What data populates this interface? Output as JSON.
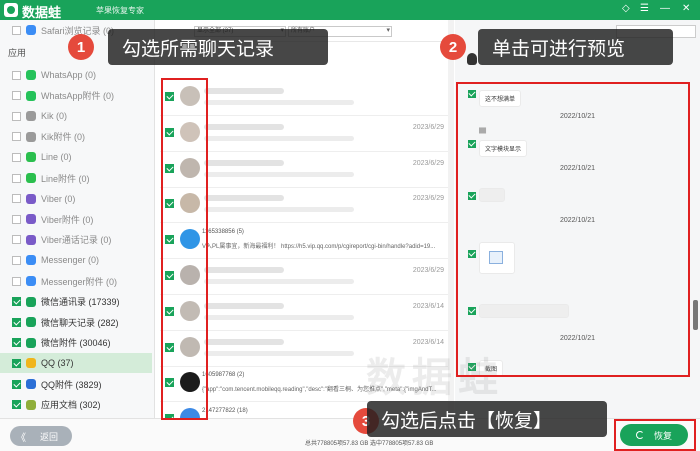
{
  "titlebar": {
    "app_name": "数据蛙",
    "subtitle": "苹果恢复专家",
    "controls": [
      "◇",
      "☰",
      "—",
      "✕"
    ]
  },
  "sidebar": {
    "top_item": "Safari浏览记录 (0)",
    "section_label": "应用",
    "items": [
      {
        "label": "WhatsApp (0)",
        "icon_color": "#25c25a",
        "checked": false
      },
      {
        "label": "WhatsApp附件 (0)",
        "icon_color": "#25c25a",
        "checked": false
      },
      {
        "label": "Kik (0)",
        "icon_color": "#9a9a9a",
        "checked": false
      },
      {
        "label": "Kik附件 (0)",
        "icon_color": "#9a9a9a",
        "checked": false
      },
      {
        "label": "Line (0)",
        "icon_color": "#2bbf4e",
        "checked": false
      },
      {
        "label": "Line附件 (0)",
        "icon_color": "#2bbf4e",
        "checked": false
      },
      {
        "label": "Viber (0)",
        "icon_color": "#7a5bc8",
        "checked": false
      },
      {
        "label": "Viber附件 (0)",
        "icon_color": "#7a5bc8",
        "checked": false
      },
      {
        "label": "Viber通话记录 (0)",
        "icon_color": "#7a5bc8",
        "checked": false
      },
      {
        "label": "Messenger (0)",
        "icon_color": "#3b8df5",
        "checked": false
      },
      {
        "label": "Messenger附件 (0)",
        "icon_color": "#3b8df5",
        "checked": false
      },
      {
        "label": "微信通讯录 (17339)",
        "icon_color": "#19a35a",
        "checked": true
      },
      {
        "label": "微信聊天记录 (282)",
        "icon_color": "#19a35a",
        "checked": true
      },
      {
        "label": "微信附件 (30046)",
        "icon_color": "#19a35a",
        "checked": true
      },
      {
        "label": "QQ (37)",
        "icon_color": "#f0b51c",
        "checked": true
      },
      {
        "label": "QQ附件 (3829)",
        "icon_color": "#2b6fd6",
        "checked": true
      },
      {
        "label": "应用文档 (302)",
        "icon_color": "#8fae3a",
        "checked": true
      }
    ]
  },
  "toolbar": {
    "filter_all": "显示全部 (37)",
    "filter_account": "所有账户"
  },
  "list": {
    "rows": [
      {
        "date": "",
        "text1": "",
        "text2": ""
      },
      {
        "date": "2023/6/29",
        "text1": "",
        "text2": ""
      },
      {
        "date": "2023/6/29",
        "text1": "",
        "text2": ""
      },
      {
        "date": "2023/6/29",
        "text1": "",
        "text2": ""
      },
      {
        "date": "",
        "text1": "1165338856 (5)",
        "text2": "V入PL属事宜，新海最福利！  https://h5.vip.qq.com/p/cgireport/cgi-bin/handle?adid=19..."
      },
      {
        "date": "2023/6/29",
        "text1": "",
        "text2": ""
      },
      {
        "date": "2023/6/14",
        "text1": "",
        "text2": ""
      },
      {
        "date": "2023/6/14",
        "text1": "",
        "text2": ""
      },
      {
        "date": "",
        "text1": "1605987768 (2)",
        "text2": "{\"app\":\"com.tencent.mobileqq.reading\",\"desc\":\"翻看三桐、为您推点\",\"meta\":{\"imgAndT..."
      },
      {
        "date": "",
        "text1": "2147277822 (18)",
        "text2": ""
      }
    ]
  },
  "preview": {
    "search_placeholder": "",
    "bubble1": "这不想满单",
    "date1": "2022/10/21",
    "bubble2": "文字模块显示",
    "date2": "2022/10/21",
    "date3": "2022/10/21",
    "date4": "2022/10/21",
    "bubble5": "截图"
  },
  "footer": {
    "back_label": "返回",
    "back_chevron": "《",
    "total_text": "总共778805项57.83 GB 选中778805项57.83 GB",
    "recover_label": "恢复"
  },
  "callouts": [
    {
      "num": "1",
      "text": "勾选所需聊天记录"
    },
    {
      "num": "2",
      "text": "单击可进行预览"
    },
    {
      "num": "3",
      "text": "勾选后点击【恢复】"
    }
  ],
  "watermark": "数据蛙"
}
